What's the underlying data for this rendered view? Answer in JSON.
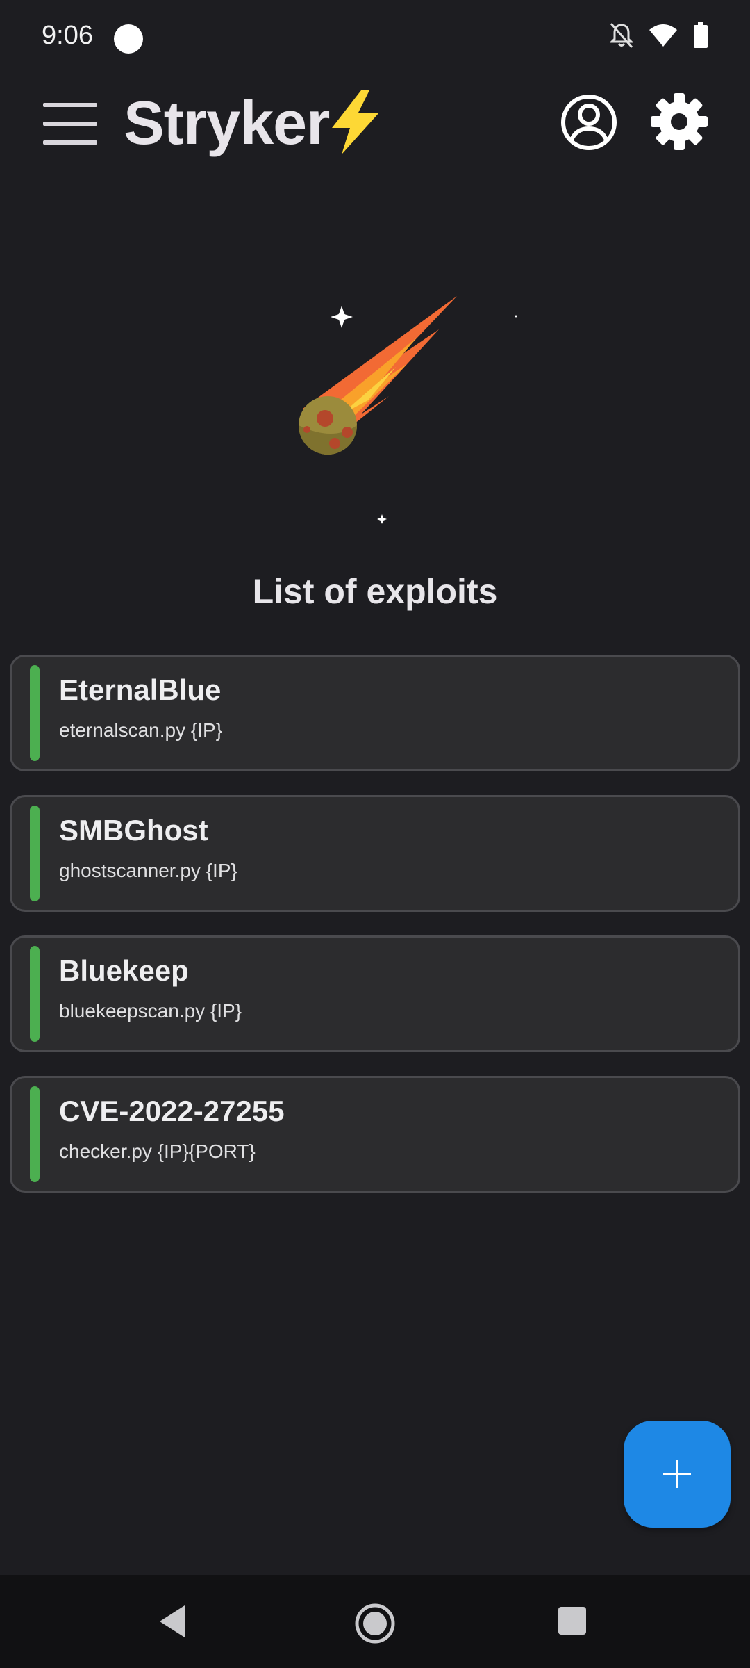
{
  "status_bar": {
    "time": "9:06",
    "icons": [
      "notifications-off-icon",
      "wifi-icon",
      "battery-icon"
    ]
  },
  "app_bar": {
    "title": "Stryker",
    "icons": [
      "menu-icon",
      "lightning-bolt-icon",
      "account-circle-icon",
      "settings-gear-icon"
    ]
  },
  "illustration": {
    "icon": "comet-icon"
  },
  "main": {
    "heading": "List of exploits",
    "exploits": [
      {
        "name": "EternalBlue",
        "command": "eternalscan.py {IP}"
      },
      {
        "name": "SMBGhost",
        "command": "ghostscanner.py {IP}"
      },
      {
        "name": "Bluekeep",
        "command": "bluekeepscan.py {IP}"
      },
      {
        "name": "CVE-2022-27255",
        "command": "checker.py {IP}{PORT}"
      }
    ]
  },
  "fab": {
    "icon": "plus-icon"
  },
  "nav_bar": {
    "icons": [
      "back-icon",
      "home-icon",
      "recents-icon"
    ]
  },
  "colors": {
    "background": "#1d1d21",
    "card": "#2c2c2e",
    "card_border": "#4a4a4e",
    "accent_green": "#4caf50",
    "fab_blue": "#1e88e5",
    "bolt_yellow": "#fdd835",
    "nav_bar": "#111113"
  }
}
